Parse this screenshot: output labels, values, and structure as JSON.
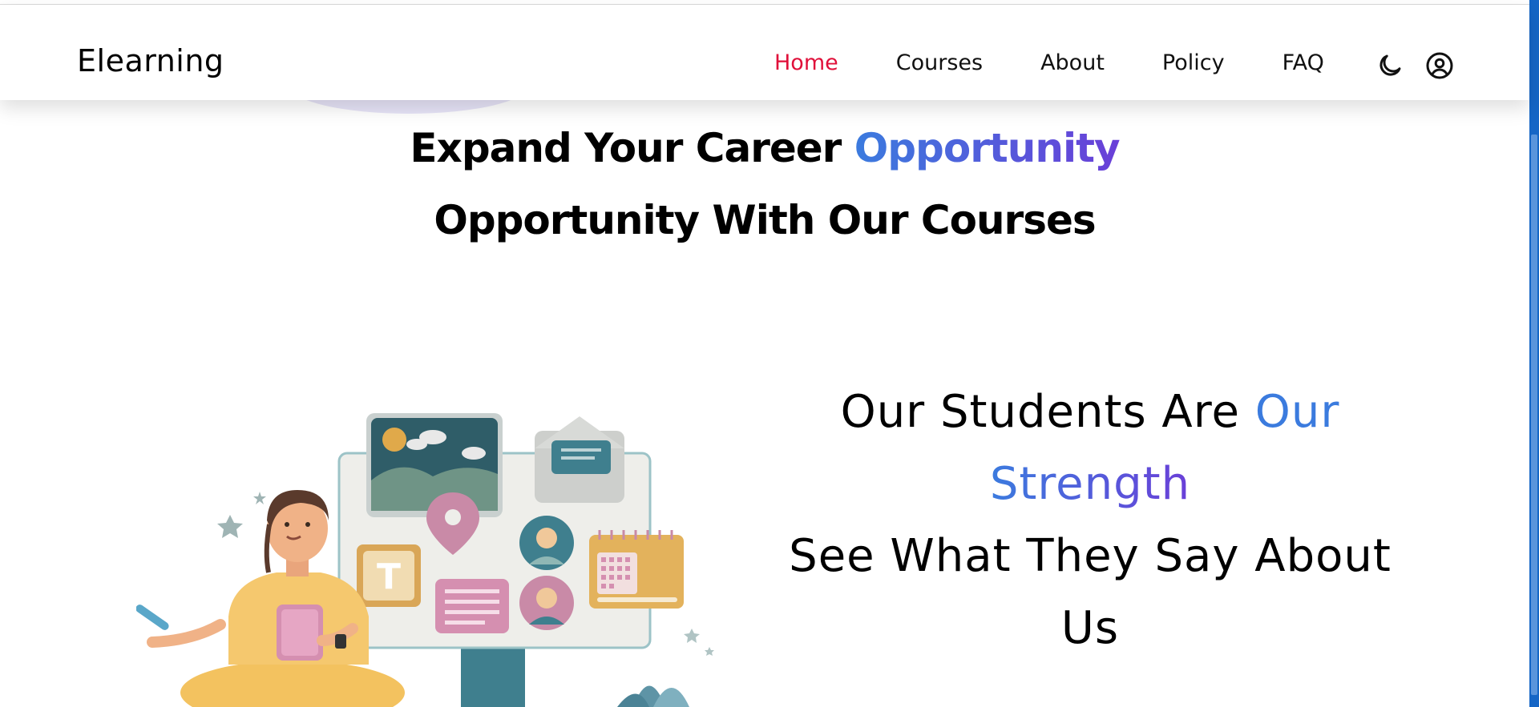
{
  "brand": {
    "name": "Elearning"
  },
  "nav": {
    "items": [
      {
        "label": "Home",
        "active": true
      },
      {
        "label": "Courses",
        "active": false
      },
      {
        "label": "About",
        "active": false
      },
      {
        "label": "Policy",
        "active": false
      },
      {
        "label": "FAQ",
        "active": false
      }
    ],
    "icons": [
      "moon-icon",
      "user-circle-icon"
    ]
  },
  "hero": {
    "line1_text": "Expand Your Career ",
    "line1_accent": "Opportunity",
    "line2": "Opportunity With Our Courses"
  },
  "testimonials": {
    "title_part1": "Our Students Are ",
    "title_accent_1": "Our",
    "title_accent_2": "Strength",
    "subtitle": "See What They Say About",
    "subtitle_end": "Us"
  },
  "colors": {
    "nav_active": "#e0103a",
    "accent_gradient_start": "#3b7bde",
    "accent_gradient_end": "#6a3fd8",
    "scrollbar": "#1566c6"
  }
}
